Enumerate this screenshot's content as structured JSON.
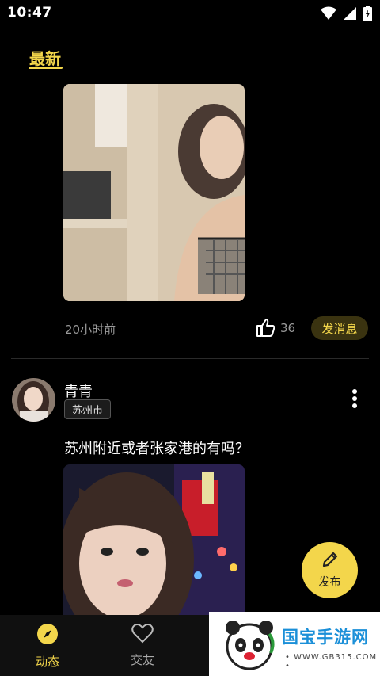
{
  "status": {
    "time": "10:47"
  },
  "tabs": {
    "latest": "最新"
  },
  "post1": {
    "time_ago": "20小时前",
    "likes": "36",
    "message_button": "发消息"
  },
  "post2": {
    "username": "青青",
    "city": "苏州市",
    "text": "苏州附近或者张家港的有吗？"
  },
  "fab": {
    "label": "发布"
  },
  "nav": {
    "items": [
      {
        "label": "动态"
      },
      {
        "label": "交友"
      }
    ]
  },
  "watermark": {
    "name": "国宝手游网",
    "url": "• WWW.GB315.COM •"
  },
  "colors": {
    "accent": "#f3d64b",
    "background": "#000000"
  }
}
